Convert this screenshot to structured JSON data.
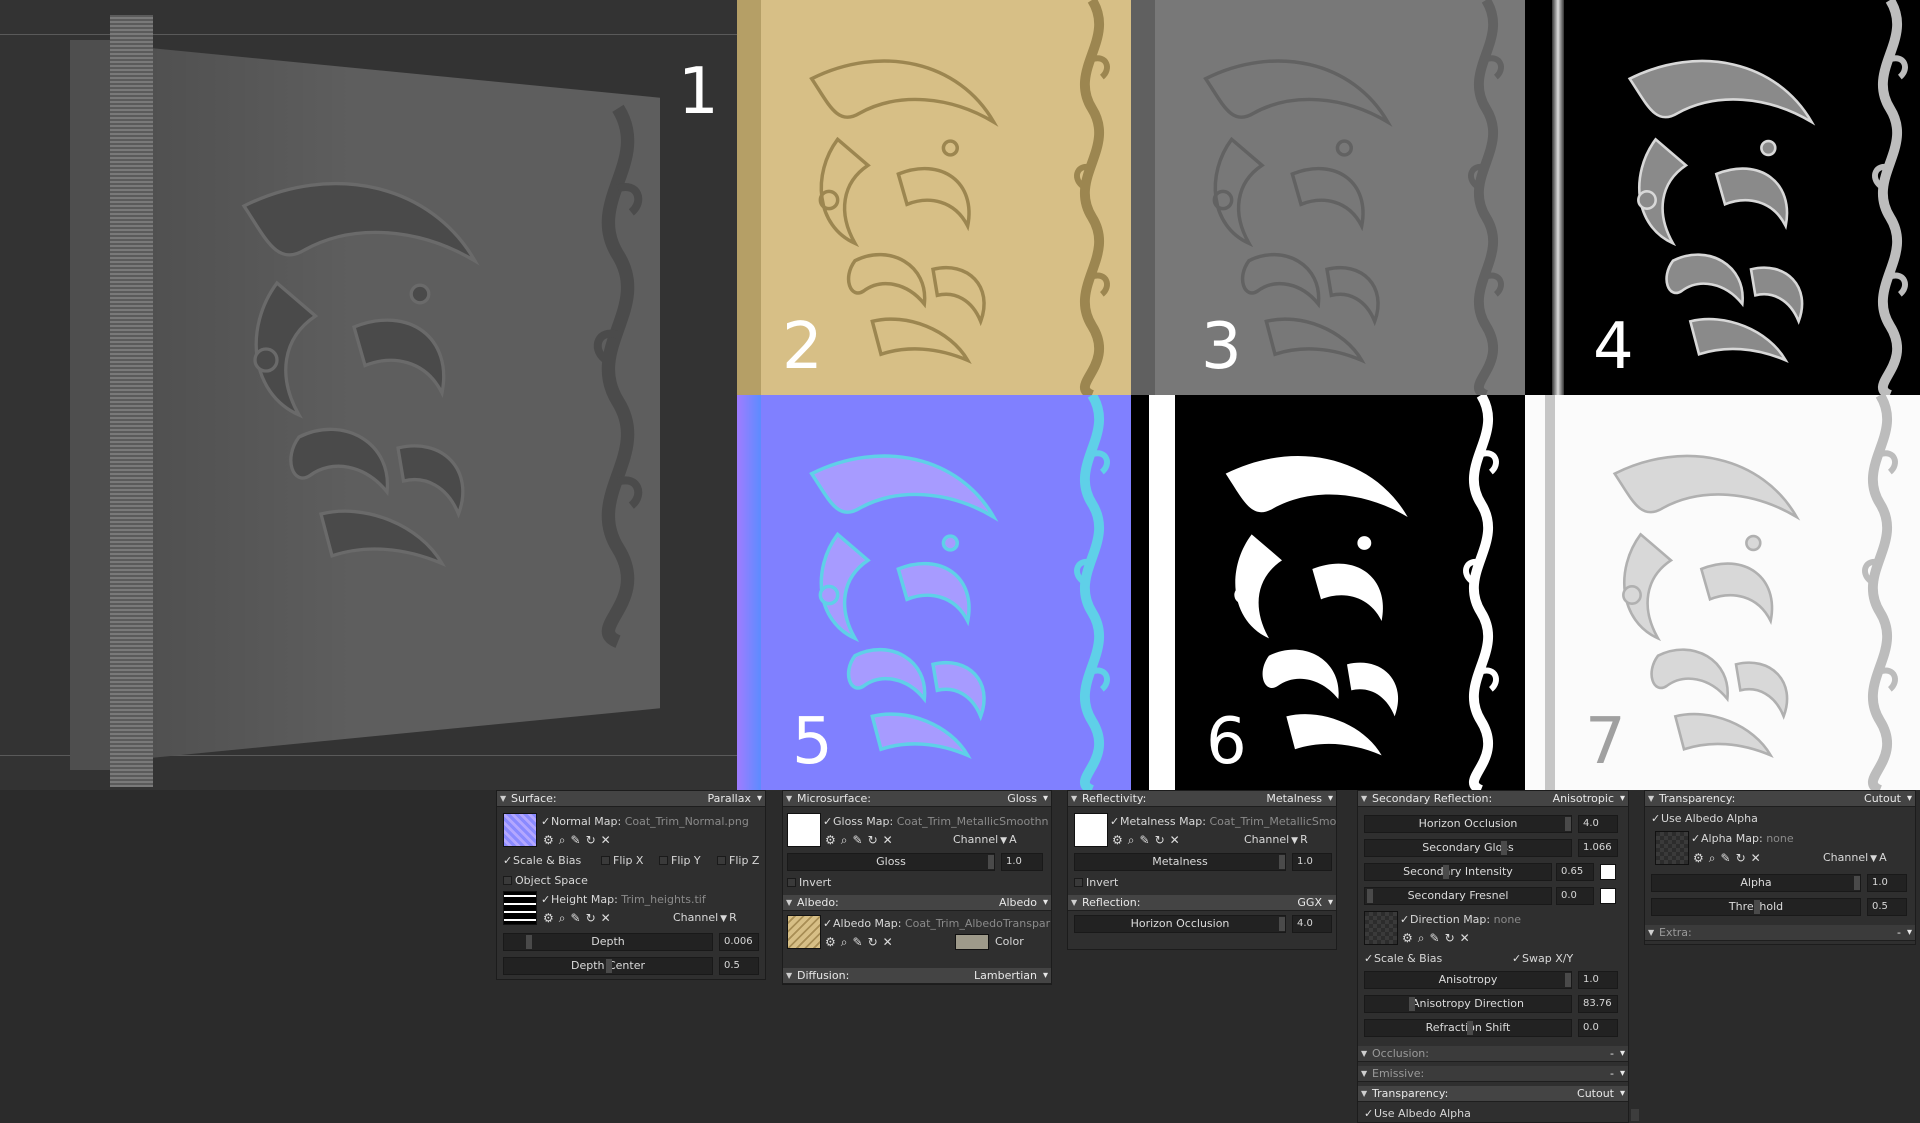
{
  "render_labels": [
    "1",
    "2",
    "3",
    "4",
    "5",
    "6",
    "7"
  ],
  "colors": {
    "albedo_tint": "#d7bf86",
    "normal_tint": "#8080ff",
    "panel_bg": "#2f2f2f",
    "panel_header": "#444444"
  },
  "surface": {
    "header": "Surface:",
    "mode": "Parallax",
    "normal_map_label": "Normal Map:",
    "normal_map_file": "Coat_Trim_Normal.png",
    "scale_bias": "Scale & Bias",
    "flip_x": "Flip X",
    "flip_y": "Flip Y",
    "flip_z": "Flip Z",
    "object_space": "Object Space",
    "height_map_label": "Height Map:",
    "height_map_file": "Trim_heights.tif",
    "channel_label": "Channel",
    "channel_value": "R",
    "depth_label": "Depth",
    "depth_value": "0.006",
    "depth_center_label": "Depth Center",
    "depth_center_value": "0.5"
  },
  "microsurface": {
    "header": "Microsurface:",
    "mode": "Gloss",
    "gloss_map_label": "Gloss Map:",
    "gloss_map_file": "Coat_Trim_MetallicSmoothn",
    "channel_label": "Channel",
    "channel_value": "A",
    "gloss_label": "Gloss",
    "gloss_value": "1.0",
    "invert": "Invert"
  },
  "albedo": {
    "header": "Albedo:",
    "mode": "Albedo",
    "albedo_map_label": "Albedo Map:",
    "albedo_map_file": "Coat_Trim_AlbedoTranspar",
    "color_label": "Color"
  },
  "diffusion": {
    "header": "Diffusion:",
    "mode": "Lambertian"
  },
  "reflectivity": {
    "header": "Reflectivity:",
    "mode": "Metalness",
    "metalness_map_label": "Metalness Map:",
    "metalness_map_file": "Coat_Trim_MetallicSmoo",
    "channel_label": "Channel",
    "channel_value": "R",
    "metalness_label": "Metalness",
    "metalness_value": "1.0",
    "invert": "Invert"
  },
  "reflection": {
    "header": "Reflection:",
    "mode": "GGX",
    "horizon_label": "Horizon Occlusion",
    "horizon_value": "4.0"
  },
  "secondary": {
    "header": "Secondary Reflection:",
    "mode": "Anisotropic",
    "horizon_label": "Horizon Occlusion",
    "horizon_value": "4.0",
    "gloss_label": "Secondary Gloss",
    "gloss_value": "1.066",
    "intensity_label": "Secondary Intensity",
    "intensity_value": "0.65",
    "fresnel_label": "Secondary Fresnel",
    "fresnel_value": "0.0",
    "direction_map_label": "Direction Map:",
    "direction_map_file": "none",
    "scale_bias": "Scale & Bias",
    "swap_xy": "Swap X/Y Direction",
    "anisotropy_label": "Anisotropy",
    "anisotropy_value": "1.0",
    "anisotropy_dir_label": "Anisotropy Direction",
    "anisotropy_dir_value": "83.76",
    "refraction_label": "Refraction Shift",
    "refraction_value": "0.0",
    "occlusion_header": "Occlusion:",
    "occlusion_mode": "-",
    "emissive_header": "Emissive:",
    "emissive_mode": "-",
    "transparency_header": "Transparency:",
    "transparency_mode": "Cutout",
    "use_albedo_alpha": "Use Albedo Alpha"
  },
  "transparency": {
    "header": "Transparency:",
    "mode": "Cutout",
    "use_albedo_alpha": "Use Albedo Alpha",
    "alpha_map_label": "Alpha Map:",
    "alpha_map_file": "none",
    "channel_label": "Channel",
    "channel_value": "A",
    "alpha_label": "Alpha",
    "alpha_value": "1.0",
    "threshold_label": "Threshold",
    "threshold_value": "0.5",
    "extra_header": "Extra:",
    "extra_mode": "-"
  }
}
